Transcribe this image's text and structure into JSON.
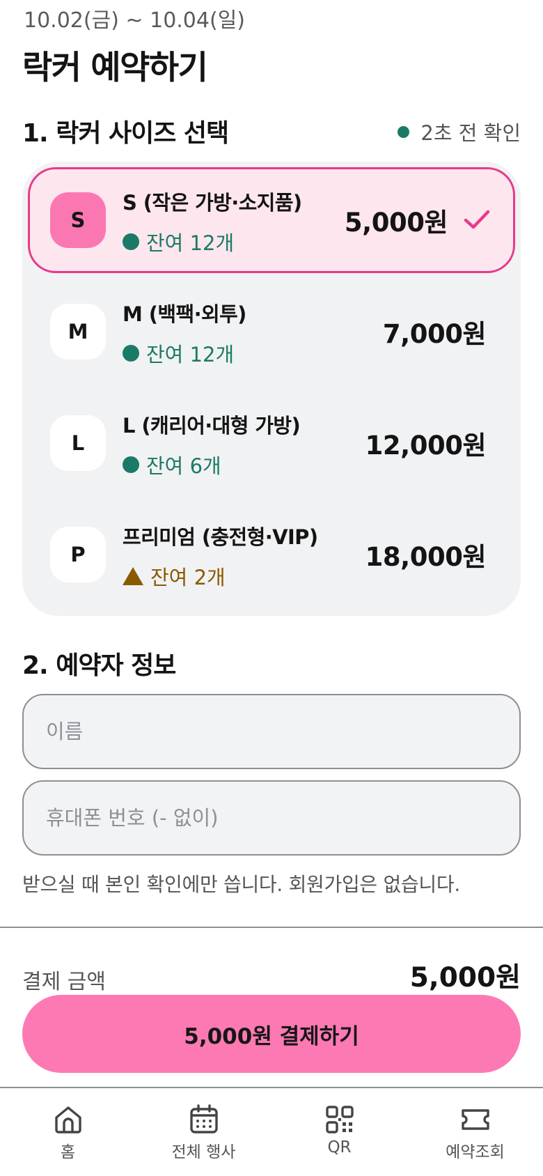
{
  "header": {
    "date_range": "10.02(금) ~ 10.04(일)",
    "title": "락커 예약하기"
  },
  "size_section": {
    "title": "1. 락커 사이즈 선택",
    "freshness": "2초 전 확인",
    "items": [
      {
        "badge": "S",
        "name": "S (작은 가방·소지품)",
        "stock": "잔여 12개",
        "price": "5,000원",
        "selected": true
      },
      {
        "badge": "M",
        "name": "M (백팩·외투)",
        "stock": "잔여 12개",
        "price": "7,000원",
        "selected": false
      },
      {
        "badge": "L",
        "name": "L (캐리어·대형 가방)",
        "stock": "잔여 6개",
        "price": "12,000원",
        "selected": false
      },
      {
        "badge": "P",
        "name": "프리미엄 (충전형·VIP)",
        "stock": "잔여 2개",
        "price": "18,000원",
        "selected": false
      }
    ]
  },
  "info_section": {
    "title": "2. 예약자 정보",
    "name_placeholder": "이름",
    "phone_placeholder": "휴대폰 번호 (- 없이)",
    "note": "받으실 때 본인 확인에만 씁니다. 회원가입은 없습니다."
  },
  "payment": {
    "label": "결제 금액",
    "amount": "5,000원",
    "button_label": "5,000원 결제하기"
  },
  "nav": {
    "home": "홈",
    "events": "전체 행사",
    "qr": "QR",
    "reservations": "예약조회"
  },
  "colors": {
    "accent": "#fd79b3",
    "selected_border": "#e8398a",
    "stock_ok": "#1b7a66",
    "stock_low": "#8a5a00"
  }
}
